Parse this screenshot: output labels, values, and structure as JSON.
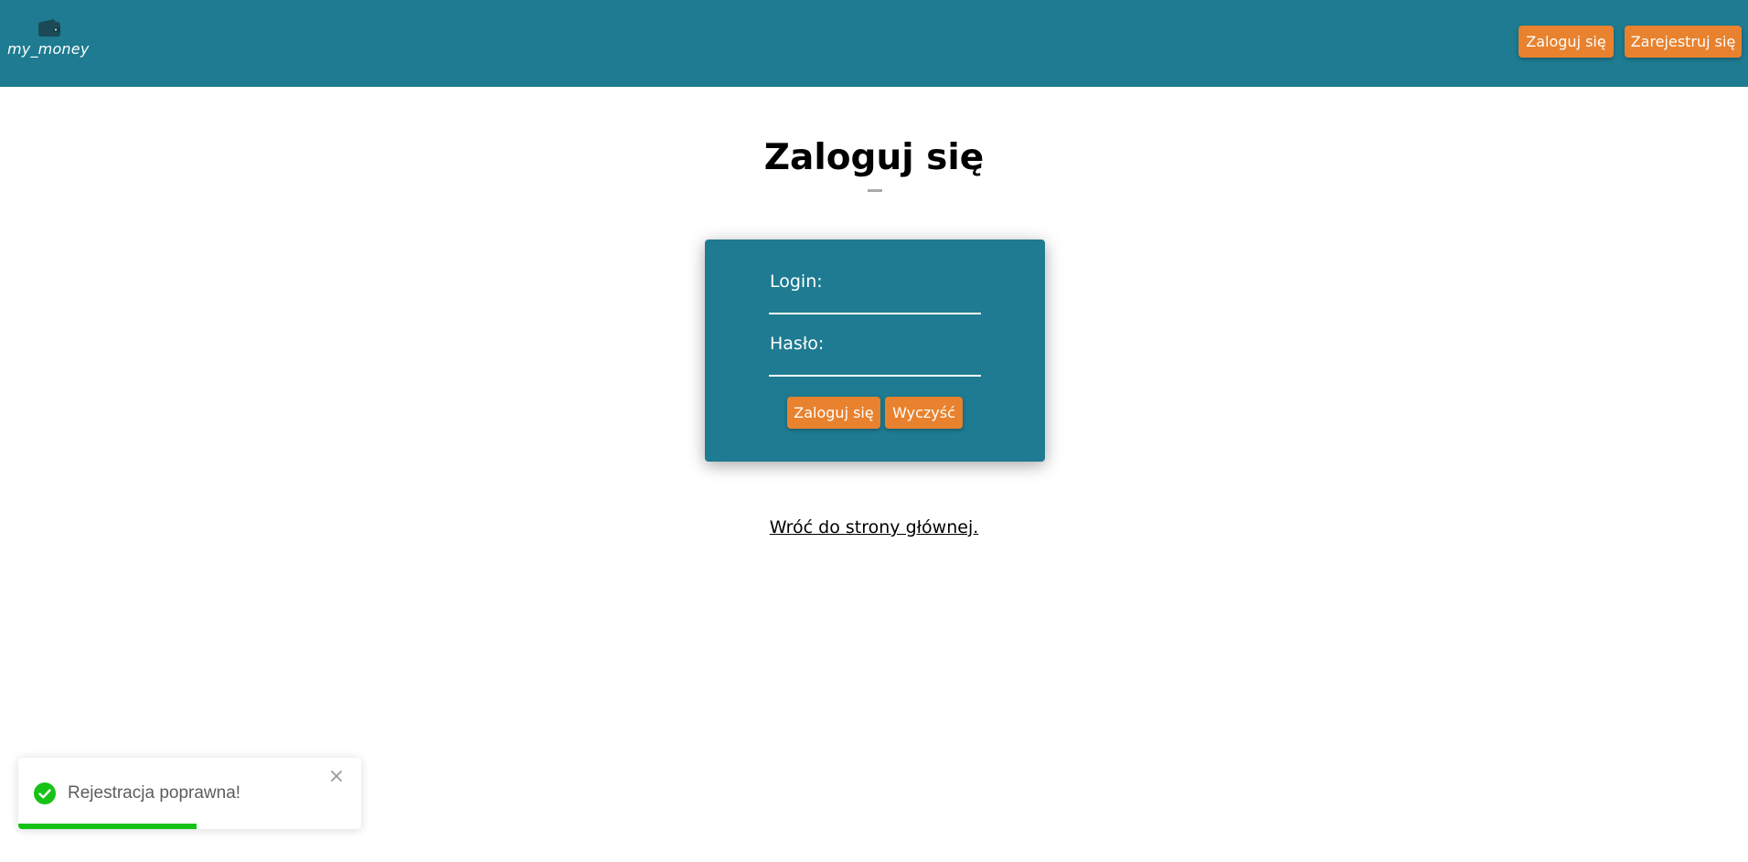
{
  "header": {
    "logo_text": "my_money",
    "nav": {
      "login_label": "Zaloguj się",
      "register_label": "Zarejestruj się"
    }
  },
  "main": {
    "title": "Zaloguj się",
    "form": {
      "login_label": "Login:",
      "login_value": "",
      "password_label": "Hasło:",
      "password_value": "",
      "submit_label": "Zaloguj się",
      "clear_label": "Wyczyść"
    },
    "back_link": "Wróć do strony głównej."
  },
  "toast": {
    "message": "Rejestracja poprawna!",
    "progress": 0.52
  },
  "colors": {
    "header_bg": "#1e7b91",
    "accent": "#e8822e",
    "success": "#17c217"
  }
}
